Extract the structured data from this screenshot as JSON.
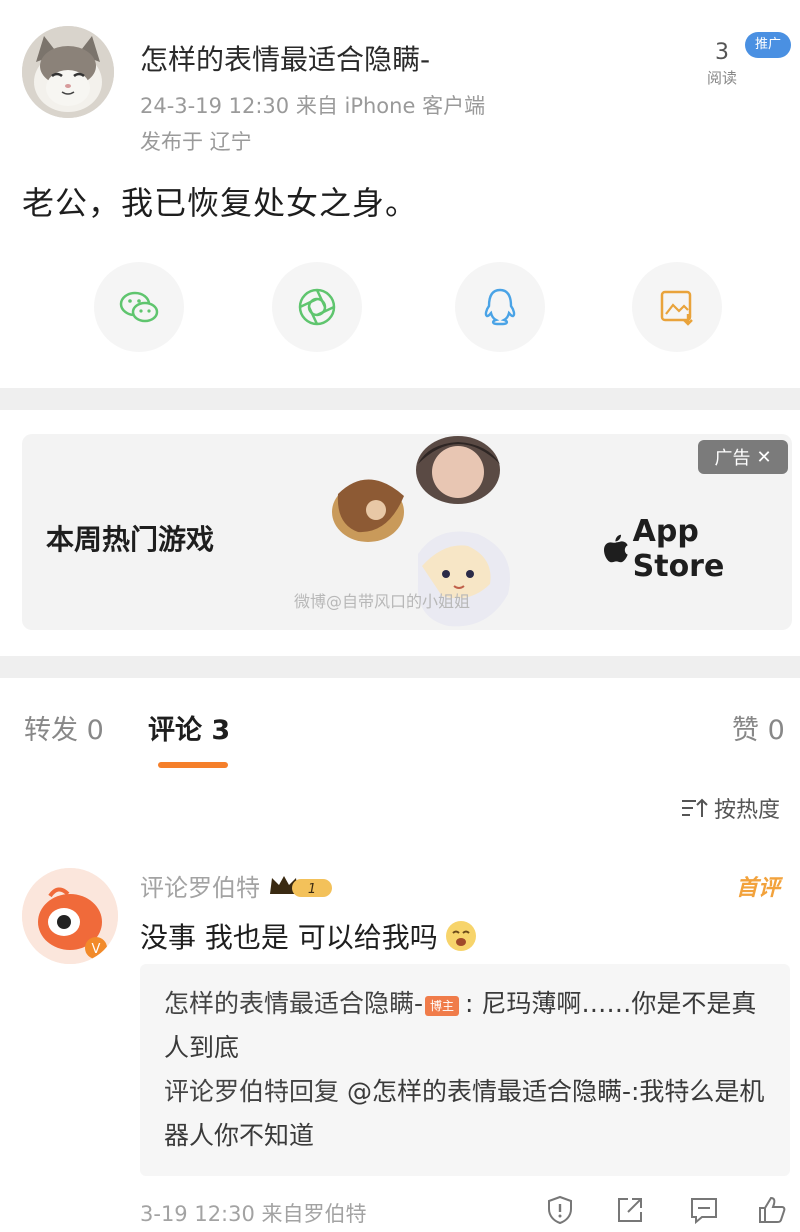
{
  "post": {
    "author_name": "怎样的表情最适合隐瞒-",
    "meta": "24-3-19 12:30  来自 iPhone 客户端",
    "location": "发布于 辽宁",
    "reads_count": "3",
    "reads_label": "阅读",
    "promo_badge": "推广",
    "body": "老公，我已恢复处女之身。"
  },
  "share_icons": [
    "wechat-icon",
    "moments-icon",
    "qq-icon",
    "save-image-icon"
  ],
  "ad": {
    "title": "本周热门游戏",
    "store": "App Store",
    "tag": "广告",
    "watermark": "微博@自带风口的小姐姐"
  },
  "tabs": {
    "repost": "转发 0",
    "comments": "评论 3",
    "likes": "赞 0"
  },
  "sort_label": "按热度",
  "comment": {
    "user_name": "评论罗伯特",
    "vip_level": "1",
    "first_badge": "首评",
    "text": "没事 我也是 可以给我吗",
    "replies": [
      {
        "author": "怎样的表情最适合隐瞒-",
        "badge": "博主",
        "text": ": 尼玛薄啊……你是不是真人到底"
      },
      {
        "author": "评论罗伯特回复",
        "mention": "@怎样的表情最适合隐瞒-",
        "text": ":我特么是机器人你不知道"
      }
    ],
    "footer": "3-19 12:30  来自罗伯特"
  },
  "colors": {
    "accent_orange": "#f57f2a",
    "first_badge": "#f2a23c",
    "promo_blue": "#4a90e2",
    "ad_tag": "#7b7b7b"
  }
}
